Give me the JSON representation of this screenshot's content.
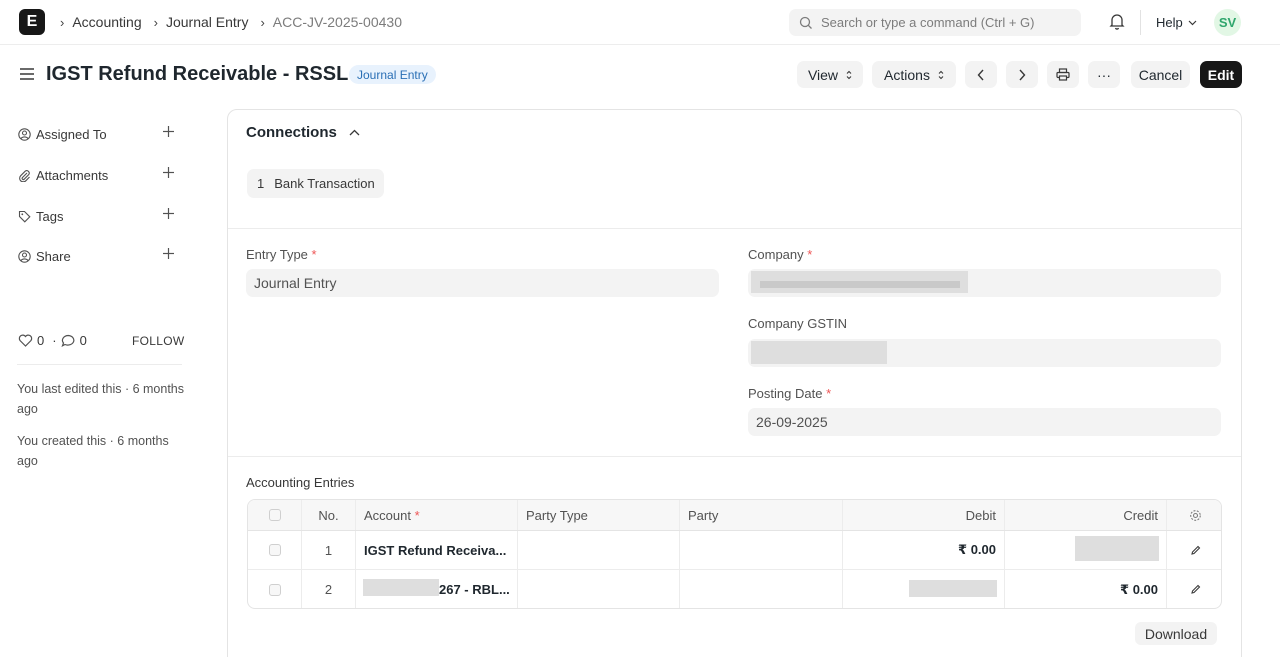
{
  "navbar": {
    "logo": "E",
    "breadcrumbs": [
      "Accounting",
      "Journal Entry",
      "ACC-JV-2025-00430"
    ],
    "search_placeholder": "Search or type a command (Ctrl + G)",
    "help_label": "Help",
    "avatar_initials": "SV"
  },
  "page": {
    "title": "IGST Refund Receivable - RSSL",
    "doctype_badge": "Journal Entry",
    "buttons": {
      "view": "View",
      "actions": "Actions",
      "more": "···",
      "cancel": "Cancel",
      "edit": "Edit"
    }
  },
  "sidebar": {
    "items": [
      {
        "label": "Assigned To",
        "icon": "user-plus-icon"
      },
      {
        "label": "Attachments",
        "icon": "paperclip-icon"
      },
      {
        "label": "Tags",
        "icon": "tag-icon"
      },
      {
        "label": "Share",
        "icon": "share-user-icon"
      }
    ],
    "likes": "0",
    "comments": "0",
    "follow_label": "FOLLOW",
    "edited_note": "You last edited this · 6 months ago",
    "created_note": "You created this · 6 months ago"
  },
  "connections": {
    "title": "Connections",
    "items": [
      {
        "count": "1",
        "label": "Bank Transaction"
      }
    ]
  },
  "form": {
    "entry_type_label": "Entry Type",
    "entry_type_value": "Journal Entry",
    "company_label": "Company",
    "company_gstin_label": "Company GSTIN",
    "posting_date_label": "Posting Date",
    "posting_date_value": "26-09-2025",
    "required_mark": "*"
  },
  "accounting_entries": {
    "label": "Accounting Entries",
    "columns": [
      "No.",
      "Account",
      "Party Type",
      "Party",
      "Debit",
      "Credit"
    ],
    "rows": [
      {
        "no": "1",
        "account": "IGST Refund Receiva...",
        "party_type": "",
        "party": "",
        "debit": "₹ 0.00",
        "credit": ""
      },
      {
        "no": "2",
        "account": "267 - RBL...",
        "party_type": "",
        "party": "",
        "debit": "",
        "credit": "₹ 0.00"
      }
    ],
    "download_label": "Download"
  },
  "colors": {
    "primary_button": "#171717",
    "badge_bg": "#e8f2fd",
    "badge_text": "#2a6fb5",
    "avatar_bg": "#e2f7e5",
    "avatar_text": "#30a66d",
    "required": "#e55555"
  }
}
